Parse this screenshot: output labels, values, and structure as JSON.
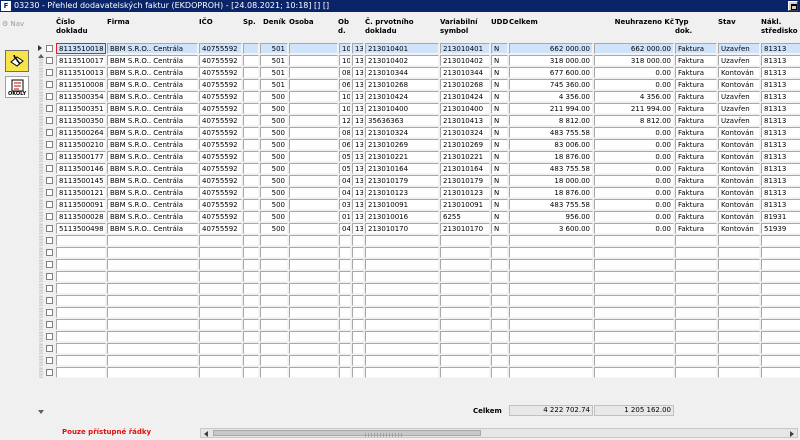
{
  "window": {
    "app_icon": "F",
    "title": "03230 - Přehled dodavatelských faktur (EKDOPROH) - [24.08.2021; 10:18]  []  []"
  },
  "sidebar": {
    "nav_label": "Nav",
    "buttons": [
      {
        "icon": "edit-document-icon"
      },
      {
        "icon": "okoly-document-icon",
        "label": "OKOLY"
      }
    ]
  },
  "table": {
    "columns": [
      {
        "key": "cislo",
        "label": "Číslo\ndokladu"
      },
      {
        "key": "firma",
        "label": "Firma"
      },
      {
        "key": "ico",
        "label": "IČO"
      },
      {
        "key": "sp",
        "label": "Sp."
      },
      {
        "key": "denik",
        "label": "Deník"
      },
      {
        "key": "osoba",
        "label": "Osoba"
      },
      {
        "key": "ob",
        "label": "Ob\nd."
      },
      {
        "key": "cprv",
        "label": "Č. prvotního\ndokladu"
      },
      {
        "key": "vs",
        "label": "Variabilní\nsymbol"
      },
      {
        "key": "udd",
        "label": "UDD"
      },
      {
        "key": "celkem",
        "label": "Celkem"
      },
      {
        "key": "neuhr",
        "label": "Neuhrazeno Kč"
      },
      {
        "key": "typ",
        "label": "Typ\ndok."
      },
      {
        "key": "stav",
        "label": "Stav"
      },
      {
        "key": "nakl",
        "label": "Nákl.\nstředisko"
      }
    ],
    "rows": [
      {
        "cislo": "8113510018",
        "firma": "BBM S.R.O.. Centrála",
        "ico": "40755592",
        "sp": "",
        "denik": "501",
        "osoba": "",
        "ob1": "10",
        "ob2": "13",
        "cprv": "213010401",
        "vs": "213010401",
        "udd": "N",
        "celkem": "662 000.00",
        "neuhr": "662 000.00",
        "typ": "Faktura",
        "stav": "Uzavřen",
        "nakl": "81313"
      },
      {
        "cislo": "8113510017",
        "firma": "BBM S.R.O.. Centrála",
        "ico": "40755592",
        "sp": "",
        "denik": "501",
        "osoba": "",
        "ob1": "10",
        "ob2": "13",
        "cprv": "213010402",
        "vs": "213010402",
        "udd": "N",
        "celkem": "318 000.00",
        "neuhr": "318 000.00",
        "typ": "Faktura",
        "stav": "Uzavřen",
        "nakl": "81313"
      },
      {
        "cislo": "8113510013",
        "firma": "BBM S.R.O.. Centrála",
        "ico": "40755592",
        "sp": "",
        "denik": "501",
        "osoba": "",
        "ob1": "08",
        "ob2": "13",
        "cprv": "213010344",
        "vs": "213010344",
        "udd": "N",
        "celkem": "677 600.00",
        "neuhr": "0.00",
        "typ": "Faktura",
        "stav": "Kontován",
        "nakl": "81313"
      },
      {
        "cislo": "8113510008",
        "firma": "BBM S.R.O.. Centrála",
        "ico": "40755592",
        "sp": "",
        "denik": "501",
        "osoba": "",
        "ob1": "06",
        "ob2": "13",
        "cprv": "213010268",
        "vs": "213010268",
        "udd": "N",
        "celkem": "745 360.00",
        "neuhr": "0.00",
        "typ": "Faktura",
        "stav": "Kontován",
        "nakl": "81313"
      },
      {
        "cislo": "8113500354",
        "firma": "BBM S.R.O.. Centrála",
        "ico": "40755592",
        "sp": "",
        "denik": "500",
        "osoba": "",
        "ob1": "10",
        "ob2": "13",
        "cprv": "213010424",
        "vs": "213010424",
        "udd": "N",
        "celkem": "4 356.00",
        "neuhr": "4 356.00",
        "typ": "Faktura",
        "stav": "Uzavřen",
        "nakl": "81313"
      },
      {
        "cislo": "8113500351",
        "firma": "BBM S.R.O.. Centrála",
        "ico": "40755592",
        "sp": "",
        "denik": "500",
        "osoba": "",
        "ob1": "10",
        "ob2": "13",
        "cprv": "213010400",
        "vs": "213010400",
        "udd": "N",
        "celkem": "211 994.00",
        "neuhr": "211 994.00",
        "typ": "Faktura",
        "stav": "Uzavřen",
        "nakl": "81313"
      },
      {
        "cislo": "8113500350",
        "firma": "BBM S.R.O.. Centrála",
        "ico": "40755592",
        "sp": "",
        "denik": "500",
        "osoba": "",
        "ob1": "12",
        "ob2": "13",
        "cprv": "35636363",
        "vs": "213010413",
        "udd": "N",
        "celkem": "8 812.00",
        "neuhr": "8 812.00",
        "typ": "Faktura",
        "stav": "Uzavřen",
        "nakl": "81313"
      },
      {
        "cislo": "8113500264",
        "firma": "BBM S.R.O.. Centrála",
        "ico": "40755592",
        "sp": "",
        "denik": "500",
        "osoba": "",
        "ob1": "08",
        "ob2": "13",
        "cprv": "213010324",
        "vs": "213010324",
        "udd": "N",
        "celkem": "483 755.58",
        "neuhr": "0.00",
        "typ": "Faktura",
        "stav": "Kontován",
        "nakl": "81313"
      },
      {
        "cislo": "8113500210",
        "firma": "BBM S.R.O.. Centrála",
        "ico": "40755592",
        "sp": "",
        "denik": "500",
        "osoba": "",
        "ob1": "06",
        "ob2": "13",
        "cprv": "213010269",
        "vs": "213010269",
        "udd": "N",
        "celkem": "83 006.00",
        "neuhr": "0.00",
        "typ": "Faktura",
        "stav": "Kontován",
        "nakl": "81313"
      },
      {
        "cislo": "8113500177",
        "firma": "BBM S.R.O.. Centrála",
        "ico": "40755592",
        "sp": "",
        "denik": "500",
        "osoba": "",
        "ob1": "05",
        "ob2": "13",
        "cprv": "213010221",
        "vs": "213010221",
        "udd": "N",
        "celkem": "18 876.00",
        "neuhr": "0.00",
        "typ": "Faktura",
        "stav": "Kontován",
        "nakl": "81313"
      },
      {
        "cislo": "8113500146",
        "firma": "BBM S.R.O.. Centrála",
        "ico": "40755592",
        "sp": "",
        "denik": "500",
        "osoba": "",
        "ob1": "05",
        "ob2": "13",
        "cprv": "213010164",
        "vs": "213010164",
        "udd": "N",
        "celkem": "483 755.58",
        "neuhr": "0.00",
        "typ": "Faktura",
        "stav": "Kontován",
        "nakl": "81313"
      },
      {
        "cislo": "8113500145",
        "firma": "BBM S.R.O.. Centrála",
        "ico": "40755592",
        "sp": "",
        "denik": "500",
        "osoba": "",
        "ob1": "04",
        "ob2": "13",
        "cprv": "213010179",
        "vs": "213010179",
        "udd": "N",
        "celkem": "18 000.00",
        "neuhr": "0.00",
        "typ": "Faktura",
        "stav": "Kontován",
        "nakl": "81313"
      },
      {
        "cislo": "8113500121",
        "firma": "BBM S.R.O.. Centrála",
        "ico": "40755592",
        "sp": "",
        "denik": "500",
        "osoba": "",
        "ob1": "04",
        "ob2": "13",
        "cprv": "213010123",
        "vs": "213010123",
        "udd": "N",
        "celkem": "18 876.00",
        "neuhr": "0.00",
        "typ": "Faktura",
        "stav": "Kontován",
        "nakl": "81313"
      },
      {
        "cislo": "8113500091",
        "firma": "BBM S.R.O.. Centrála",
        "ico": "40755592",
        "sp": "",
        "denik": "500",
        "osoba": "",
        "ob1": "03",
        "ob2": "13",
        "cprv": "213010091",
        "vs": "213010091",
        "udd": "N",
        "celkem": "483 755.58",
        "neuhr": "0.00",
        "typ": "Faktura",
        "stav": "Kontován",
        "nakl": "81313"
      },
      {
        "cislo": "8113500028",
        "firma": "BBM S.R.O.. Centrála",
        "ico": "40755592",
        "sp": "",
        "denik": "500",
        "osoba": "",
        "ob1": "01",
        "ob2": "13",
        "cprv": "213010016",
        "vs": "6255",
        "udd": "N",
        "celkem": "956.00",
        "neuhr": "0.00",
        "typ": "Faktura",
        "stav": "Kontován",
        "nakl": "81931"
      },
      {
        "cislo": "5113500498",
        "firma": "BBM S.R.O.. Centrála",
        "ico": "40755592",
        "sp": "",
        "denik": "500",
        "osoba": "",
        "ob1": "04",
        "ob2": "13",
        "cprv": "213010170",
        "vs": "213010170",
        "udd": "N",
        "celkem": "3 600.00",
        "neuhr": "0.00",
        "typ": "Faktura",
        "stav": "Kontován",
        "nakl": "51939"
      }
    ],
    "empty_row_count": 12,
    "selected_row": 0
  },
  "totals": {
    "label": "Celkem",
    "celkem": "4 222 702.74",
    "neuhrazeno": "1 205 162.00"
  },
  "status": {
    "message": "Pouze přístupné řádky"
  },
  "colors": {
    "titlebar": "#0a246a",
    "selection": "#cfe3fb",
    "status_text": "#e01010",
    "focus_border": "#e02020"
  }
}
